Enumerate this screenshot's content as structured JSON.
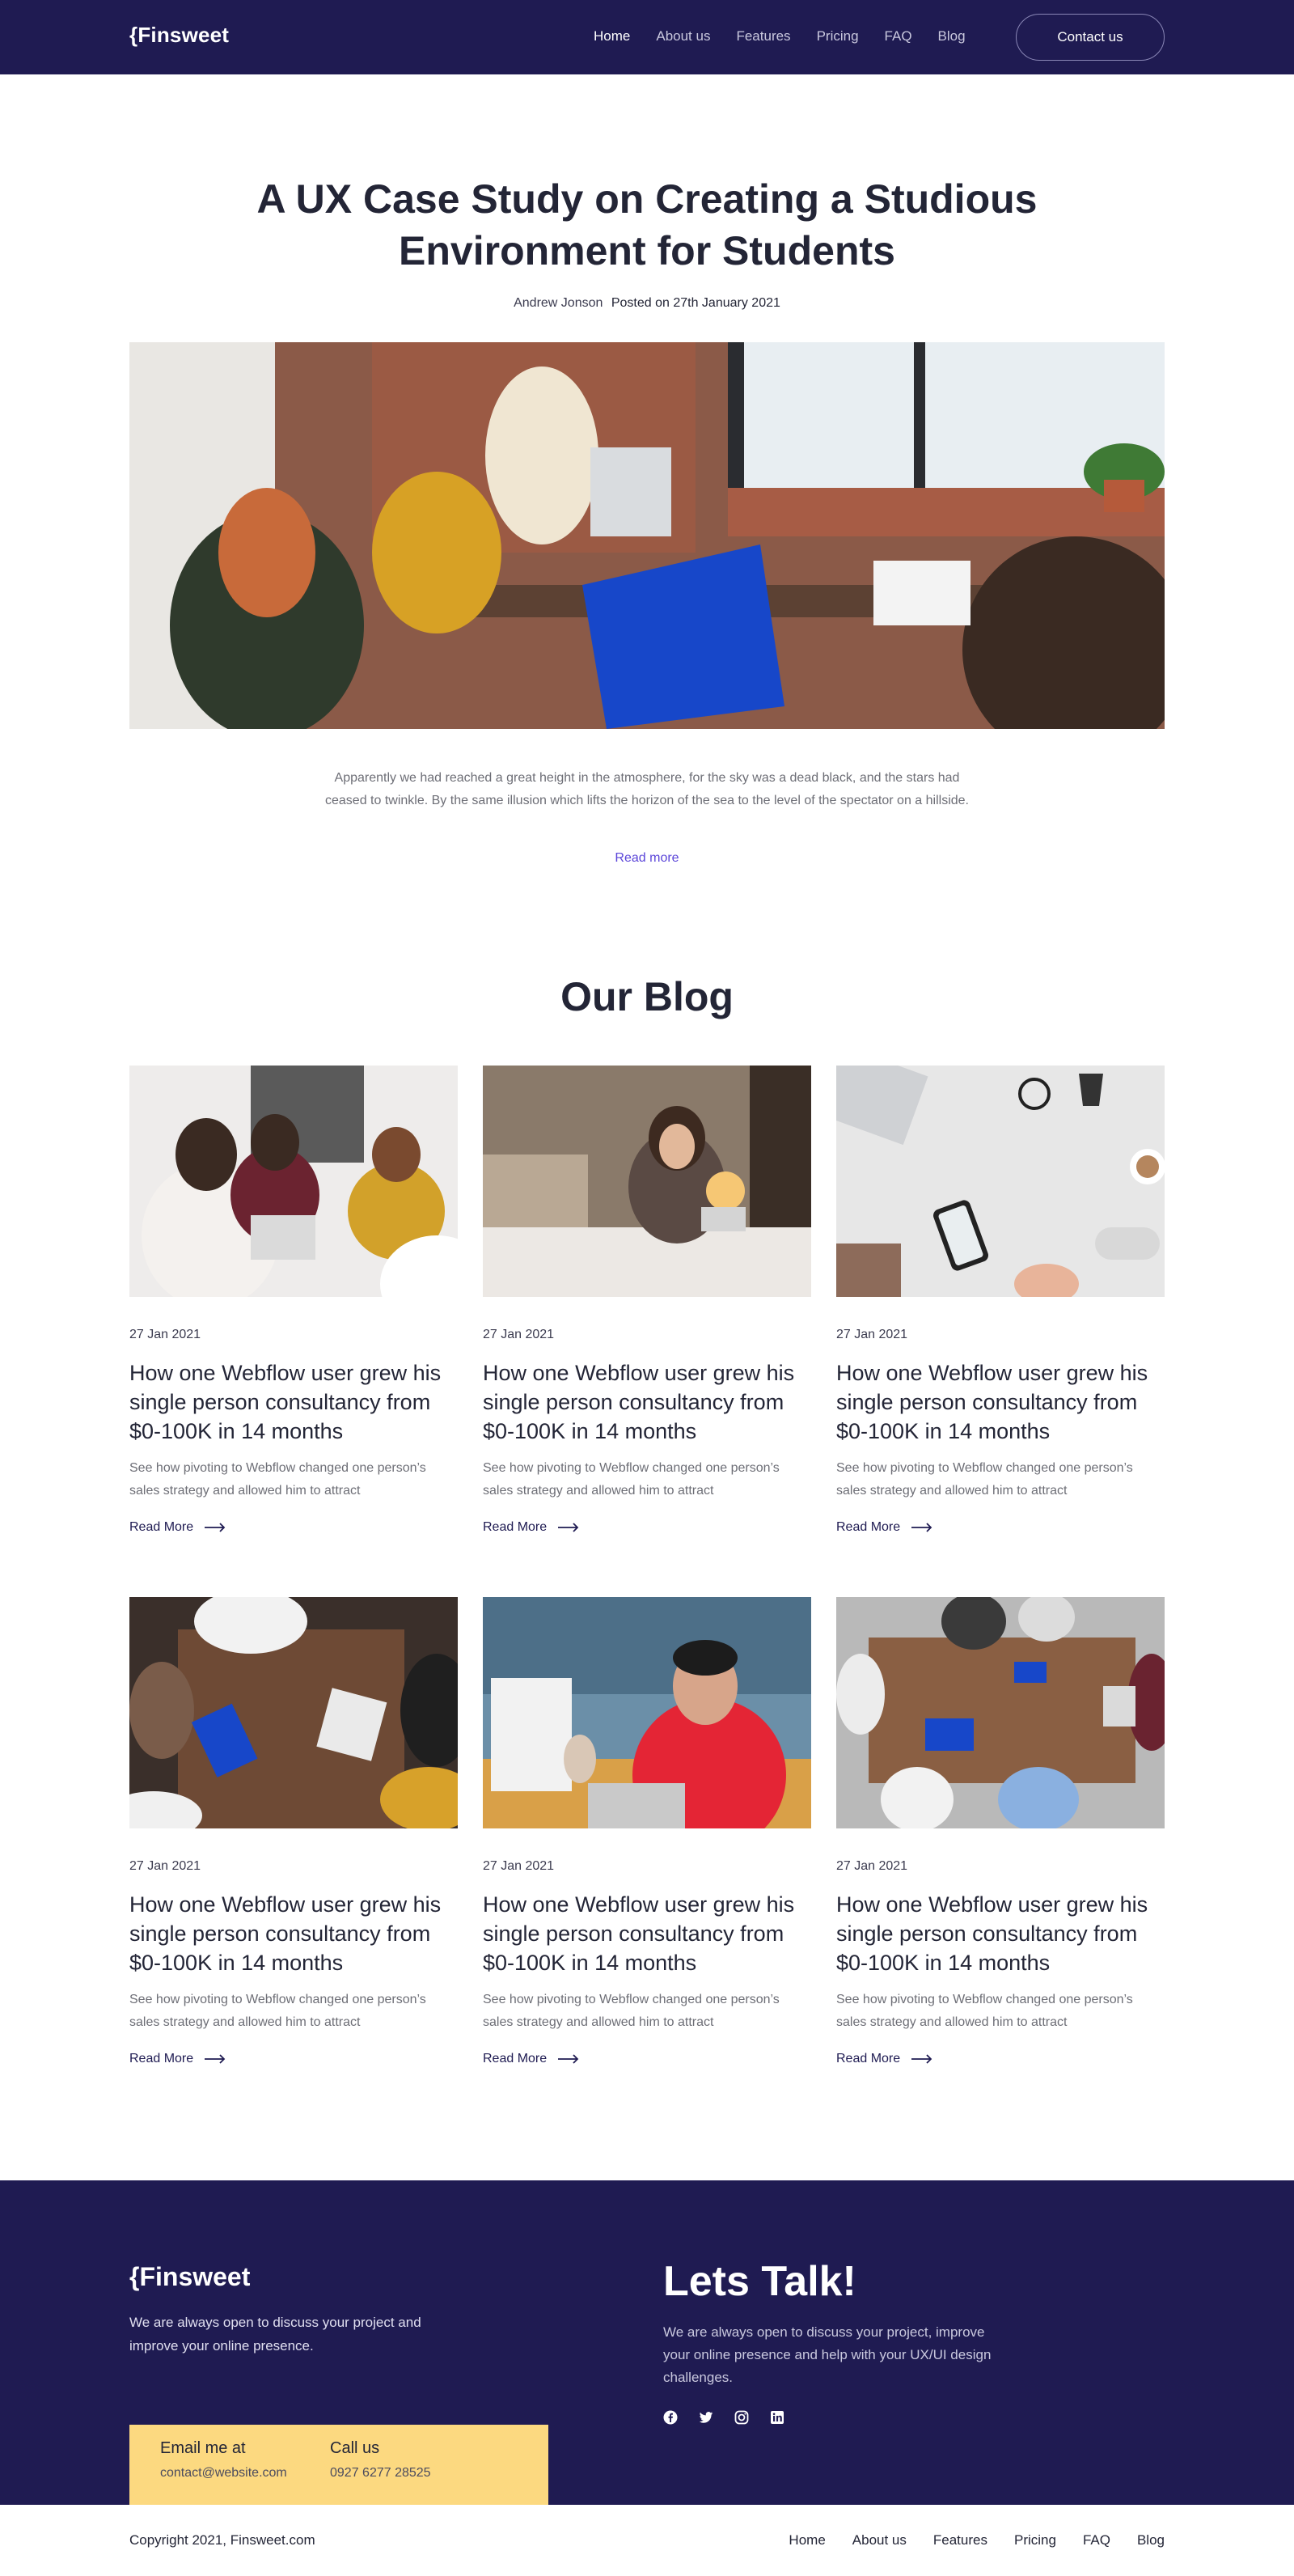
{
  "nav": {
    "logo": "{Finsweet",
    "links": [
      "Home",
      "About us",
      "Features",
      "Pricing",
      "FAQ",
      "Blog"
    ],
    "active": "Home",
    "contact_label": "Contact us"
  },
  "hero": {
    "title": "A UX Case Study on Creating a Studious Environment for Students",
    "author": "Andrew Jonson",
    "posted": "Posted on 27th January 2021",
    "image_alt": "people working at a table",
    "description": "Apparently we had reached a great height in the atmosphere, for the sky was a dead black, and the stars had ceased to twinkle. By the same illusion which lifts the horizon of the sea to the level of the spectator on a hillside.",
    "read_more": "Read more"
  },
  "blog": {
    "heading": "Our Blog",
    "posts": [
      {
        "date": "27 Jan 2021",
        "title": "How one Webflow user grew his single person consultancy from $0-100K in 14 months",
        "excerpt": "See how pivoting to Webflow changed one person’s sales strategy and allowed him to attract",
        "more": "Read More"
      },
      {
        "date": "27 Jan 2021",
        "title": "How one Webflow user grew his single person consultancy from $0-100K in 14 months",
        "excerpt": "See how pivoting to Webflow changed one person’s sales strategy and allowed him to attract",
        "more": "Read More"
      },
      {
        "date": "27 Jan 2021",
        "title": "How one Webflow user grew his single person consultancy from $0-100K in 14 months",
        "excerpt": "See how pivoting to Webflow changed one person’s sales strategy and allowed him to attract",
        "more": "Read More"
      },
      {
        "date": "27 Jan 2021",
        "title": "How one Webflow user grew his single person consultancy from $0-100K in 14 months",
        "excerpt": "See how pivoting to Webflow changed one person’s sales strategy and allowed him to attract",
        "more": "Read More"
      },
      {
        "date": "27 Jan 2021",
        "title": "How one Webflow user grew his single person consultancy from $0-100K in 14 months",
        "excerpt": "See how pivoting to Webflow changed one person’s sales strategy and allowed him to attract",
        "more": "Read More"
      },
      {
        "date": "27 Jan 2021",
        "title": "How one Webflow user grew his single person consultancy from $0-100K in 14 months",
        "excerpt": "See how pivoting to Webflow changed one person’s sales strategy and allowed him to attract",
        "more": "Read More"
      }
    ]
  },
  "footer": {
    "logo": "{Finsweet",
    "desc": "We are always open to discuss your project and improve your online presence.",
    "email_label": "Email me at",
    "email": "contact@website.com",
    "call_label": "Call us",
    "phone": "0927 6277 28525",
    "talk_title": "Lets Talk!",
    "talk_desc": "We are always open to discuss your project, improve your online presence and help with your UX/UI design challenges.",
    "socials": [
      "facebook-icon",
      "twitter-icon",
      "instagram-icon",
      "linkedin-icon"
    ],
    "copyright": "Copyright 2021, Finsweet.com",
    "links": [
      "Home",
      "About us",
      "Features",
      "Pricing",
      "FAQ",
      "Blog"
    ]
  },
  "colors": {
    "navy": "#1f1b52",
    "accent": "#5b45d9",
    "yellow": "#fcd980",
    "text": "#232536"
  }
}
